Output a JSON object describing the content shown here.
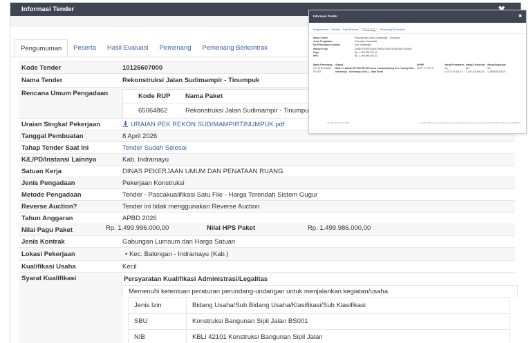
{
  "modal": {
    "title": "Informasi Tender",
    "close": "✖"
  },
  "tabs": [
    "Pengumuman",
    "Peserta",
    "Hasil Evaluasi",
    "Pemenang",
    "Pemenang Berkontrak"
  ],
  "fields": {
    "kode_tender": {
      "label": "Kode Tender",
      "value": "10126607000"
    },
    "nama_tender": {
      "label": "Nama Tender",
      "value": "Rekonstruksi Jalan Sudimampir - Tinumpuk"
    },
    "rup": {
      "label": "Rencana Umum Pengadaan",
      "col_kode": "Kode RUP",
      "col_nama": "Nama Paket",
      "kode": "65064862",
      "nama": "Rekonstruksi Jalan Sudimampir - Tinumpuk"
    },
    "uraian": {
      "label": "Uraian Singkat Pekerjaan",
      "value": "URAIAN PEK REKON SUDIMAMPIRTINUMPUK.pdf"
    },
    "tanggal": {
      "label": "Tanggal Pembuatan",
      "value": "8 April 2026"
    },
    "tahap": {
      "label": "Tahap Tender Saat Ini",
      "value": "Tender Sudah Selesai"
    },
    "klpd": {
      "label": "K/L/PD/Instansi Lainnya",
      "value": "Kab. Indramayu"
    },
    "satker": {
      "label": "Satuan Kerja",
      "value": "DINAS PEKERJAAN UMUM DAN PENATAAN RUANG"
    },
    "jenis": {
      "label": "Jenis Pengadaan",
      "value": "Pekerjaan Konstruksi"
    },
    "metode": {
      "label": "Metode Pengadaan",
      "value": "Tender - Pascakualifikasi Satu File - Harga Terendah Sistem Gugur"
    },
    "reverse": {
      "label": "Reverse Auction?",
      "value": "Tender ini tidak menggunakan Reverse Auction"
    },
    "tahun": {
      "label": "Tahun Anggaran",
      "value": "APBD 2026"
    },
    "pagu": {
      "label": "Nilai Pagu Paket",
      "value": "Rp. 1.499.996.000,00",
      "hps_label": "Nilai HPS Paket",
      "hps_value": "Rp. 1.499.986.000,00"
    },
    "kontrak": {
      "label": "Jenis Kontrak",
      "value": "Gabungan Lumsum dan Harga Satuan"
    },
    "lokasi": {
      "label": "Lokasi Pekerjaan",
      "value": "Kec. Balongan - Indramayu (Kab.)"
    },
    "kualifikasi": {
      "label": "Kualifikasi Usaha",
      "value": "Kecil"
    },
    "syarat": {
      "label": "Syarat Kualifikasi",
      "title": "Persyaratan Kualifikasi Administrasi/Legalitas",
      "subtitle": "Memenuhi ketentuan peraturan perundang-undangan untuk menjalankan kegiatan/usaha.",
      "rows": [
        {
          "k": "Jenis Izin",
          "v": "Bidang Usaha/Sub Bidang Usaha/Klasifikasi/Sub Klasifikasi"
        },
        {
          "k": "SBU",
          "v": "Konstruksi Bangunan Sipil Jalan BS001"
        },
        {
          "k": "NIB",
          "v": "KBLI 42101 Konstruksi Bangunan Sipil Jalan"
        }
      ]
    }
  },
  "mini": {
    "title": "Informasi Tender",
    "tabs": [
      "Pengumuman",
      "Peserta",
      "Hasil Evaluasi",
      "Pemenang",
      "Pemenang Berkontrak"
    ],
    "rows": [
      {
        "k": "Nama Tender",
        "v": "Rekonstruksi Jalan Sudimampir - Tinumpuk"
      },
      {
        "k": "Jenis Pengadaan",
        "v": "Pekerjaan Konstruksi"
      },
      {
        "k": "K/L/PD/Instansi Lainnya",
        "v": "Kab. Indramayu"
      },
      {
        "k": "Satuan Kerja",
        "v": "DINAS PEKERJAAN UMUM DAN PENATAAN RUANG"
      },
      {
        "k": "Pagu",
        "v": "Rp. 1.499.996.000,00"
      },
      {
        "k": "HPS",
        "v": "Rp. 1.499.986.000,00"
      }
    ],
    "table_head": [
      "Nama Pemenang",
      "Alamat",
      "NPWP",
      "Harga Penawaran",
      "Harga Terkoreksi",
      "Harga Negosiasi"
    ],
    "table_row": [
      "CV.CITRA DANA SEJATI",
      "Blok. H. Wardhi RT.008 RW.003 Desa. Lamarantarung Kec. Cantigi Kab. Indramayu - Indramayu (Kab.) - Jawa Barat",
      "02*5**1***27**5",
      "Rp. 1.470.110.626,23",
      "Rp. 1.470.110.626,23",
      "Rp. 1.458.806.445,70"
    ],
    "footer_left": "26 Mei 2026 21:30 WIB",
    "footer_right": "© 2009-2026 Lembaga Kebijakan Pengadaan Barang/Jasa Pemerintah (LKPP) Aplikasi SPSE v4.5u20230727"
  }
}
